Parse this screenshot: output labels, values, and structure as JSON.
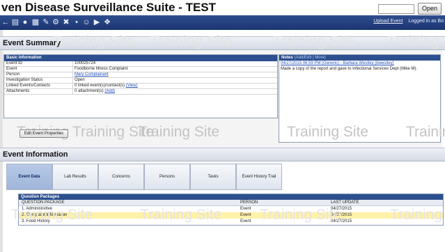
{
  "app": {
    "title": "ven Disease Surveillance Suite - TEST",
    "open_button": "Open"
  },
  "toolbar": {
    "icons": [
      "back-arrow-icon",
      "list-icon",
      "people-icon",
      "grid-icon",
      "edit-icon",
      "settings-icon",
      "tools-icon",
      "spacer-icon",
      "person-icon",
      "car-icon",
      "tools2-icon"
    ],
    "upload_event": "Upload Event",
    "logged_in_text": "Logged in as Bo"
  },
  "watermark": "Training Site",
  "event_summary": {
    "title": "Event Summary",
    "basic_info": {
      "header": "Basic Information",
      "rows": [
        {
          "label": "Event ID",
          "value": "100025724",
          "is_link": false
        },
        {
          "label": "Event",
          "value": "Foodborne Illness Complaint",
          "is_link": false
        },
        {
          "label": "Person",
          "value": "Mary Complainant",
          "is_link": true
        },
        {
          "label": "Investigation Status",
          "value": "Open",
          "is_link": false
        },
        {
          "label": "Linked Events/Contacts",
          "value": "0 linked event(s)/contact(s)",
          "link": "(View)"
        },
        {
          "label": "Attachments",
          "value": "0 attachment(s)",
          "link": "(Add)"
        }
      ]
    },
    "notes": {
      "header": "Notes",
      "header_links": "(Add/Edit | More)",
      "entries": [
        {
          "timestamp": "04/27/2015 06:59 PM (Generic) - Barbara Westley (bwestley)"
        },
        {
          "text": "Made a copy of the report and gave to Infectional Services Dept (Mike M)."
        }
      ]
    },
    "edit_button": "Edit Event Properties"
  },
  "event_information": {
    "title": "Event Information",
    "tabs": [
      {
        "label": "Event Data",
        "active": true
      },
      {
        "label": "Lab Results",
        "active": false
      },
      {
        "label": "Concerns",
        "active": false
      },
      {
        "label": "Persons",
        "active": false
      },
      {
        "label": "Tasks",
        "active": false
      },
      {
        "label": "Event History Trail",
        "active": false
      }
    ],
    "question_packages": {
      "header": "Question Packages",
      "columns": [
        "QUESTION PACKAGE",
        "PERSON",
        "LAST UPDATE"
      ],
      "rows": [
        {
          "package": "1. Administrative",
          "person": "Event",
          "last_update": "04/27/2015",
          "highlight": false
        },
        {
          "package": "2. Complaint Information",
          "person": "Event",
          "last_update": "04/27/2015",
          "highlight": true
        },
        {
          "package": "3. Food History",
          "person": "Event",
          "last_update": "04/27/2015",
          "highlight": false
        }
      ]
    }
  }
}
